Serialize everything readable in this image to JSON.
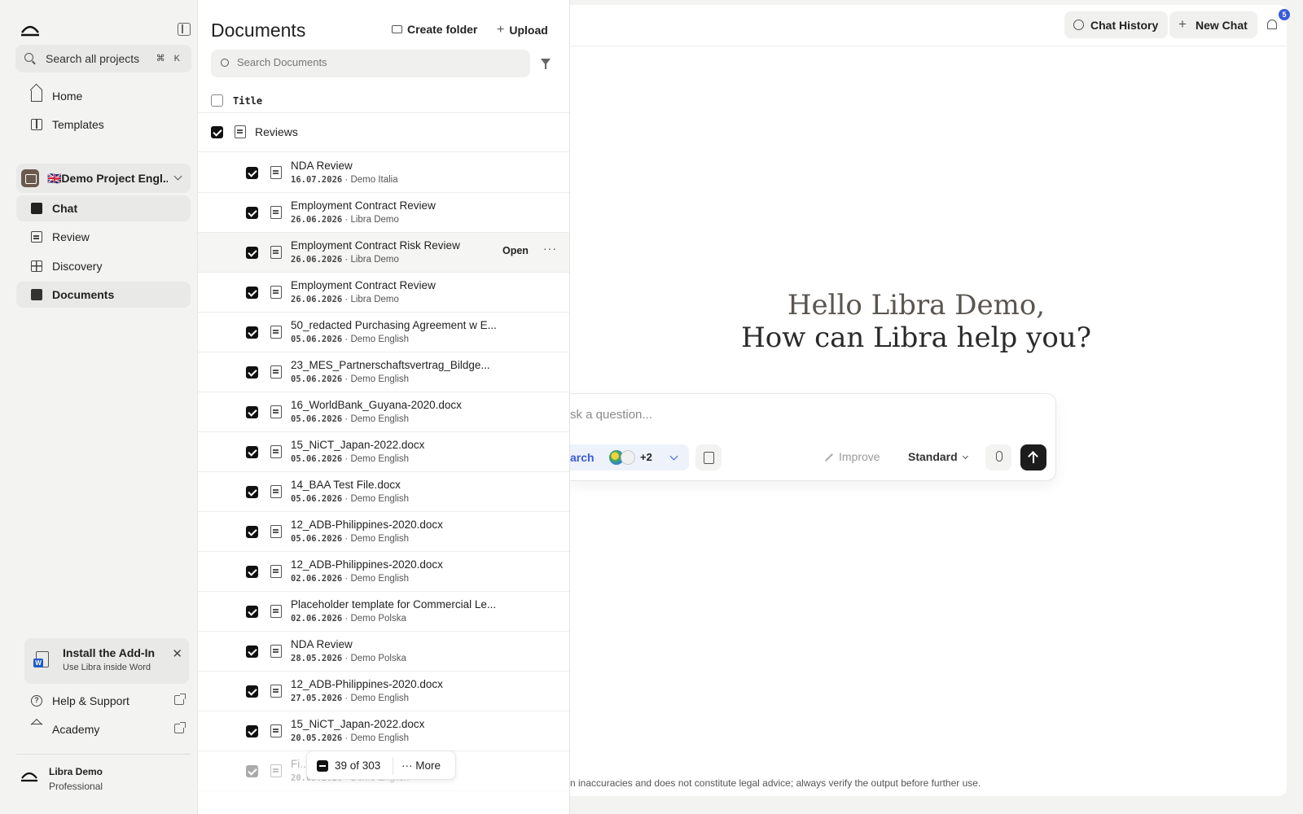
{
  "sidebar": {
    "search_label": "Search all projects",
    "search_shortcut": "⌘ K",
    "nav_top": [
      {
        "label": "Home",
        "icon": "home-icon"
      },
      {
        "label": "Templates",
        "icon": "book-icon"
      }
    ],
    "project_name": "🇬🇧Demo Project Engl...",
    "nav_project": [
      {
        "label": "Chat",
        "icon": "chat-icon",
        "active": true
      },
      {
        "label": "Review",
        "icon": "document-icon",
        "active": false
      },
      {
        "label": "Discovery",
        "icon": "grid-icon",
        "active": false
      },
      {
        "label": "Documents",
        "icon": "documents-icon",
        "active": true
      }
    ],
    "addin": {
      "title": "Install the Add-In",
      "subtitle": "Use Libra inside Word"
    },
    "help_label": "Help & Support",
    "academy_label": "Academy",
    "user": {
      "name": "Libra Demo",
      "plan": "Professional"
    }
  },
  "documents": {
    "title": "Documents",
    "create_folder": "Create folder",
    "upload": "Upload",
    "search_placeholder": "Search Documents",
    "column_title": "Title",
    "group_label": "Reviews",
    "open_label": "Open",
    "rows": [
      {
        "name": "NDA Review",
        "date": "16.07.2026",
        "owner": "Demo Italia"
      },
      {
        "name": "Employment Contract Review",
        "date": "26.06.2026",
        "owner": "Libra Demo"
      },
      {
        "name": "Employment Contract Risk Review",
        "date": "26.06.2026",
        "owner": "Libra Demo",
        "hover": true
      },
      {
        "name": "Employment Contract Review",
        "date": "26.06.2026",
        "owner": "Libra Demo"
      },
      {
        "name": "50_redacted Purchasing Agreement w E...",
        "date": "05.06.2026",
        "owner": "Demo English"
      },
      {
        "name": "23_MES_Partnerschaftsvertrag_Bildge...",
        "date": "05.06.2026",
        "owner": "Demo English"
      },
      {
        "name": "16_WorldBank_Guyana-2020.docx",
        "date": "05.06.2026",
        "owner": "Demo English"
      },
      {
        "name": "15_NiCT_Japan-2022.docx",
        "date": "05.06.2026",
        "owner": "Demo English"
      },
      {
        "name": "14_BAA Test File.docx",
        "date": "05.06.2026",
        "owner": "Demo English"
      },
      {
        "name": "12_ADB-Philippines-2020.docx",
        "date": "05.06.2026",
        "owner": "Demo English"
      },
      {
        "name": "12_ADB-Philippines-2020.docx",
        "date": "02.06.2026",
        "owner": "Demo English"
      },
      {
        "name": "Placeholder template for Commercial Le...",
        "date": "02.06.2026",
        "owner": "Demo Polska"
      },
      {
        "name": "NDA Review",
        "date": "28.05.2026",
        "owner": "Demo Polska"
      },
      {
        "name": "12_ADB-Philippines-2020.docx",
        "date": "27.05.2026",
        "owner": "Demo English"
      },
      {
        "name": "15_NiCT_Japan-2022.docx",
        "date": "20.05.2026",
        "owner": "Demo English"
      },
      {
        "name": "Fi...S_NEW...",
        "date": "20.05.2026",
        "owner": "Demo English",
        "faded": true
      }
    ],
    "selection_count": "39 of 303",
    "more_label": "More"
  },
  "main": {
    "chat_history": "Chat History",
    "new_chat": "New Chat",
    "notification_count": "5",
    "greeting_line1": "Hello Libra Demo,",
    "greeting_line2": "How can Libra help you?",
    "input_placeholder": "sk a question...",
    "search_chip": "arch",
    "search_extra": "+2",
    "improve": "Improve",
    "mode": "Standard",
    "disclaimer": "n inaccuracies and does not constitute legal advice; always verify the output before further use."
  },
  "colors": {
    "accent": "#3a5bd9",
    "primary_dark": "#1c1c1c"
  }
}
